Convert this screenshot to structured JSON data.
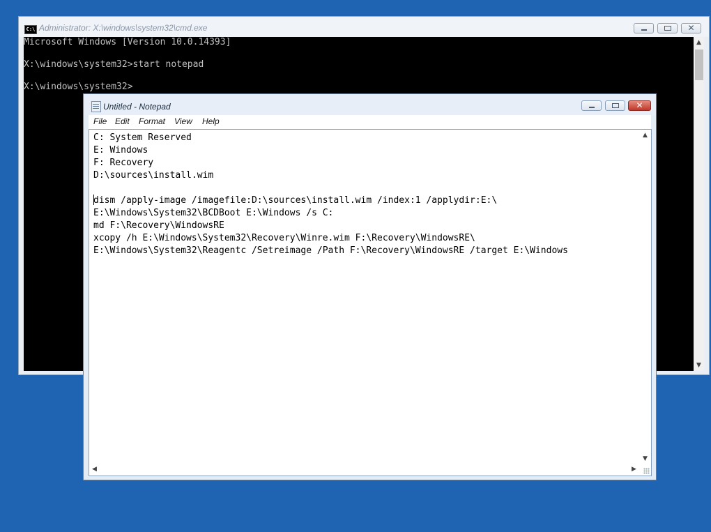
{
  "cmd": {
    "title": "Administrator: X:\\windows\\system32\\cmd.exe",
    "icon_label": "C:\\",
    "lines": [
      "Microsoft Windows [Version 10.0.14393]",
      "",
      "X:\\windows\\system32>start notepad",
      "",
      "X:\\windows\\system32>"
    ]
  },
  "notepad": {
    "title": "Untitled - Notepad",
    "menu": [
      "File",
      "Edit",
      "Format",
      "View",
      "Help"
    ],
    "lines": [
      "C: System Reserved",
      "E: Windows",
      "F: Recovery",
      "D:\\sources\\install.wim",
      "",
      "dism /apply-image /imagefile:D:\\sources\\install.wim /index:1 /applydir:E:\\",
      "E:\\Windows\\System32\\BCDBoot E:\\Windows /s C:",
      "md F:\\Recovery\\WindowsRE",
      "xcopy /h E:\\Windows\\System32\\Recovery\\Winre.wim F:\\Recovery\\WindowsRE\\",
      "E:\\Windows\\System32\\Reagentc /Setreimage /Path F:\\Recovery\\WindowsRE /target E:\\Windows"
    ]
  },
  "icons": {
    "minimize": "minimize-icon",
    "maximize": "maximize-icon",
    "close": "close-icon",
    "close_glyph": "✕",
    "up": "▲",
    "down": "▼",
    "left": "◀",
    "right": "▶"
  },
  "colors": {
    "desktop": "#1f64b3",
    "console_bg": "#000000",
    "console_fg": "#c0c0c0",
    "close_button": "#c0392b"
  }
}
